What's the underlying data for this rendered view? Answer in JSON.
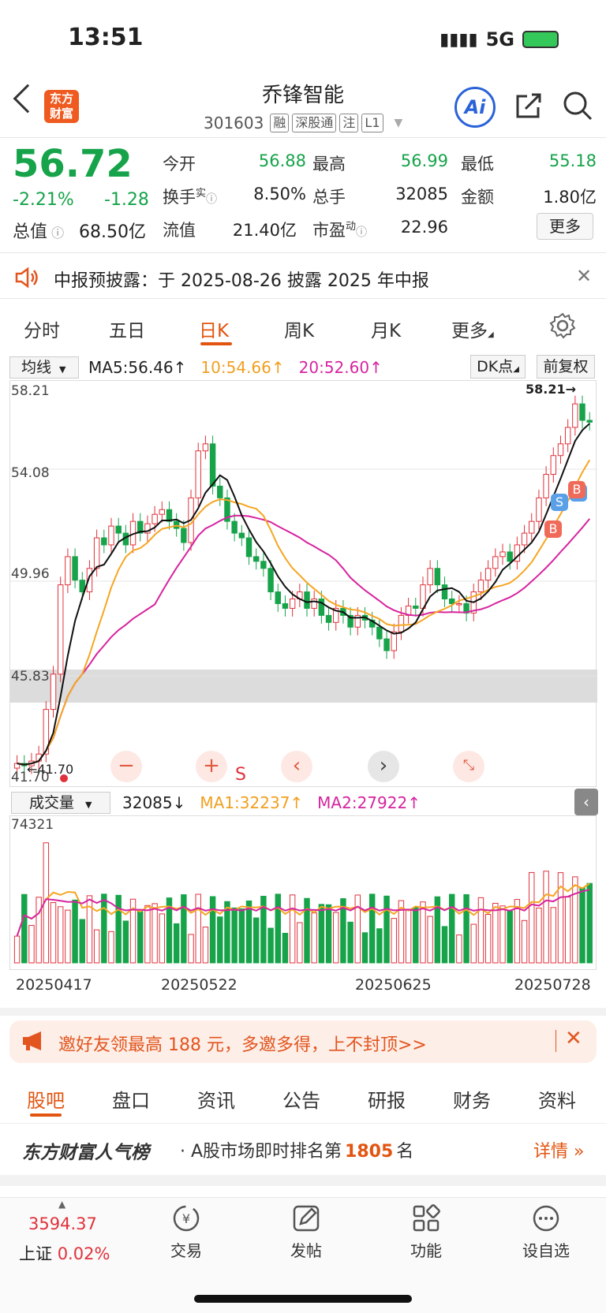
{
  "status_bar": {
    "time": "13:51",
    "network": "5G"
  },
  "header": {
    "logo_line1": "东方",
    "logo_line2": "财富",
    "stock_name": "乔锋智能",
    "stock_code": "301603",
    "tags": [
      "融",
      "深股通",
      "注",
      "L1"
    ],
    "ai_label": "Ai"
  },
  "quote": {
    "price": "56.72",
    "change_pct": "-2.21%",
    "change": "-1.28",
    "open_label": "今开",
    "open": "56.88",
    "high_label": "最高",
    "high": "56.99",
    "low_label": "最低",
    "low": "55.18",
    "turnover_label": "换手",
    "turnover_sup": "实",
    "turnover": "8.50%",
    "volume_label": "总手",
    "volume": "32085",
    "amount_label": "金额",
    "amount": "1.80亿",
    "mktcap_label": "总值",
    "mktcap": "68.50亿",
    "float_label": "流值",
    "float": "21.40亿",
    "pe_label": "市盈",
    "pe_sup": "动",
    "pe": "22.96",
    "more_label": "更多"
  },
  "notice": {
    "text": "中报预披露：于 2025-08-26 披露 2025 年中报"
  },
  "period_tabs": [
    "分时",
    "五日",
    "日K",
    "周K",
    "月K",
    "更多"
  ],
  "ma_bar": {
    "select": "均线",
    "ma5": "MA5:56.46↑",
    "ma10": "10:54.66↑",
    "ma20": "20:52.60↑",
    "dk": "DK点",
    "adjust": "前复权"
  },
  "chart_data": {
    "type": "candlestick",
    "y_ticks": [
      "58.21",
      "54.08",
      "49.96",
      "45.83",
      "41.70"
    ],
    "ylim": [
      41.7,
      58.21
    ],
    "high_marker": "58.21",
    "low_marker": "41.70",
    "dates": [
      "20250417",
      "20250522",
      "20250625",
      "20250728"
    ],
    "series_colors": {
      "ma5": "#111111",
      "ma10": "#f5a623",
      "ma20": "#d6249f",
      "up": "#e0323b",
      "down": "#16a34a"
    }
  },
  "volume": {
    "select": "成交量",
    "value": "32085↓",
    "ma1": "MA1:32237↑",
    "ma2": "MA2:27922↑",
    "max_label": "74321"
  },
  "chart_controls": {
    "s_label": "S"
  },
  "markers": {
    "b": "B",
    "s": "S"
  },
  "ad": {
    "text": "邀好友领最高 188 元，多邀多得，上不封顶>>"
  },
  "content_tabs": [
    "股吧",
    "盘口",
    "资讯",
    "公告",
    "研报",
    "财务",
    "资料"
  ],
  "rank": {
    "brand": "东方财富人气榜",
    "prefix": "· A股市场即时排名第",
    "number": "1805",
    "suffix": "名",
    "detail": "详情"
  },
  "bottom_nav": {
    "index_value": "3594.37",
    "index_name": "上证",
    "index_change": "0.02%",
    "items": [
      "交易",
      "发帖",
      "功能",
      "设自选"
    ]
  }
}
